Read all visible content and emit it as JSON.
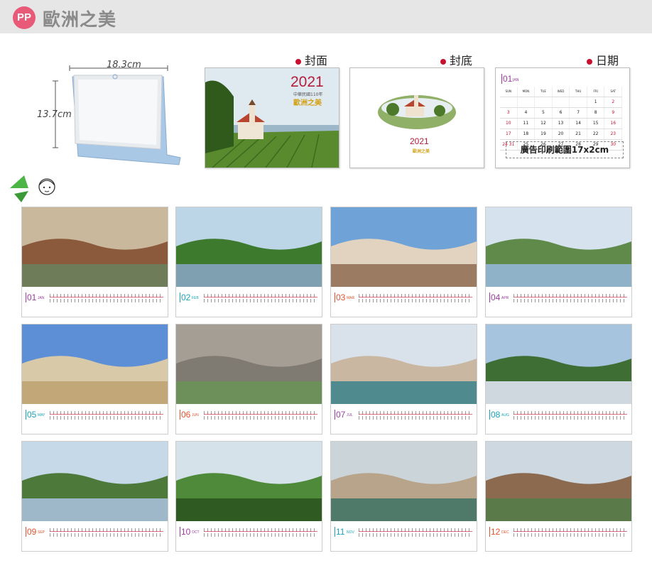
{
  "header": {
    "badge": "PP",
    "title": "歐洲之美"
  },
  "stand": {
    "width_label": "18.3cm",
    "height_label": "13.7cm"
  },
  "previews": {
    "cover": {
      "label": "封面",
      "year": "2021",
      "subtitle": "中華民國110年",
      "name": "歐洲之美"
    },
    "back": {
      "label": "封底",
      "year": "2021",
      "name": "歐洲之美"
    },
    "date": {
      "label": "日期",
      "month_num": "01",
      "month_name": "JAN",
      "weekdays": [
        "SUN",
        "MON",
        "TUE",
        "WED",
        "THU",
        "FRI",
        "SAT"
      ],
      "weeks": [
        [
          "",
          "",
          "",
          "",
          "",
          "1",
          "2"
        ],
        [
          "3",
          "4",
          "5",
          "6",
          "7",
          "8",
          "9"
        ],
        [
          "10",
          "11",
          "12",
          "13",
          "14",
          "15",
          "16"
        ],
        [
          "17",
          "18",
          "19",
          "20",
          "21",
          "22",
          "23"
        ],
        [
          "24 31",
          "25",
          "26",
          "27",
          "28",
          "29",
          "30"
        ]
      ],
      "ad_text": "廣告印刷範圍17x2cm"
    }
  },
  "months": [
    {
      "num": "01",
      "name": "JAN",
      "color": "#9b3aa0"
    },
    {
      "num": "02",
      "name": "FEB",
      "color": "#1aa3b8"
    },
    {
      "num": "03",
      "name": "MAR",
      "color": "#e0532c"
    },
    {
      "num": "04",
      "name": "APR",
      "color": "#9b3aa0"
    },
    {
      "num": "05",
      "name": "MAY",
      "color": "#1aa3b8"
    },
    {
      "num": "06",
      "name": "JUN",
      "color": "#e0532c"
    },
    {
      "num": "07",
      "name": "JUL",
      "color": "#9b3aa0"
    },
    {
      "num": "08",
      "name": "AUG",
      "color": "#1aa3b8"
    },
    {
      "num": "09",
      "name": "SEP",
      "color": "#e0532c"
    },
    {
      "num": "10",
      "name": "OCT",
      "color": "#9b3aa0"
    },
    {
      "num": "11",
      "name": "NOV",
      "color": "#1aa3b8"
    },
    {
      "num": "12",
      "name": "DEC",
      "color": "#e0532c"
    }
  ],
  "colors": {
    "brand": "#e85a78",
    "accent_red": "#c8102e",
    "header_bg": "#e6e6e6"
  }
}
